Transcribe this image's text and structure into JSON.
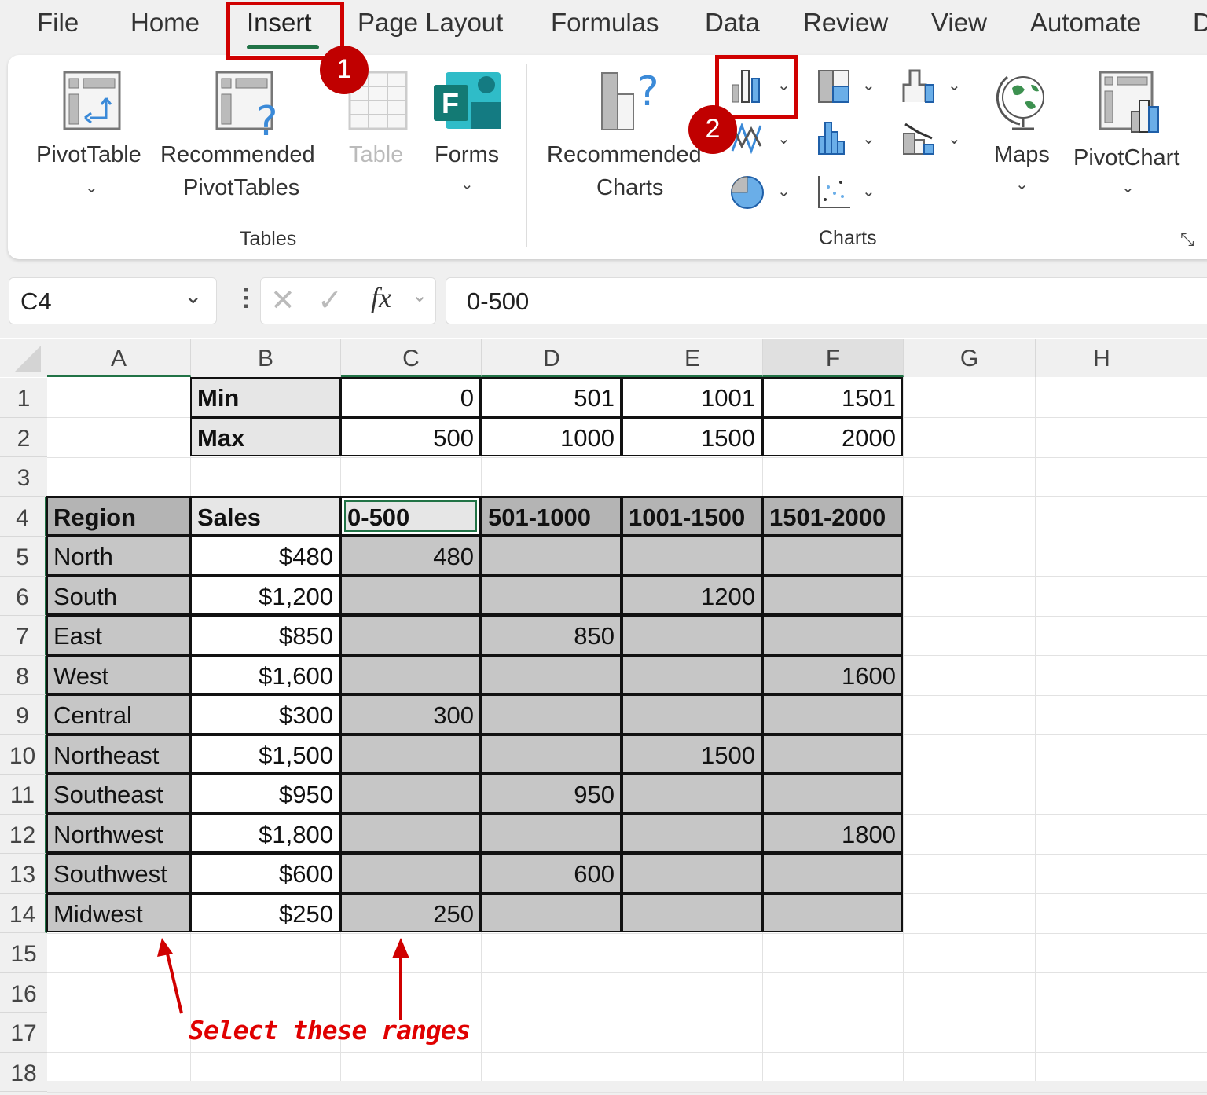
{
  "menu": {
    "tabs": [
      "File",
      "Home",
      "Insert",
      "Page Layout",
      "Formulas",
      "Data",
      "Review",
      "View",
      "Automate",
      "D"
    ],
    "active": "Insert"
  },
  "ribbon": {
    "tables_group": "Tables",
    "charts_group": "Charts",
    "pivottable": "PivotTable",
    "recommended_pivot_1": "Recommended",
    "recommended_pivot_2": "PivotTables",
    "table": "Table",
    "forms": "Forms",
    "recommended_charts_1": "Recommended",
    "recommended_charts_2": "Charts",
    "maps": "Maps",
    "pivotchart": "PivotChart"
  },
  "badges": {
    "step1": "1",
    "step2": "2"
  },
  "formula_bar": {
    "name_box": "C4",
    "fx": "fx",
    "value": "0-500"
  },
  "columns": [
    "A",
    "B",
    "C",
    "D",
    "E",
    "F",
    "G",
    "H"
  ],
  "rows": [
    "1",
    "2",
    "3",
    "4",
    "5",
    "6",
    "7",
    "8",
    "9",
    "10",
    "11",
    "12",
    "13",
    "14",
    "15",
    "16",
    "17",
    "18"
  ],
  "bins": {
    "min_label": "Min",
    "max_label": "Max",
    "min": [
      "0",
      "501",
      "1001",
      "1501"
    ],
    "max": [
      "500",
      "1000",
      "1500",
      "2000"
    ]
  },
  "table": {
    "headers": [
      "Region",
      "Sales",
      "0-500",
      "501-1000",
      "1001-1500",
      "1501-2000"
    ],
    "rows": [
      [
        "North",
        "$480",
        "480",
        "",
        "",
        ""
      ],
      [
        "South",
        "$1,200",
        "",
        "",
        "1200",
        ""
      ],
      [
        "East",
        "$850",
        "",
        "850",
        "",
        ""
      ],
      [
        "West",
        "$1,600",
        "",
        "",
        "",
        "1600"
      ],
      [
        "Central",
        "$300",
        "300",
        "",
        "",
        ""
      ],
      [
        "Northeast",
        "$1,500",
        "",
        "",
        "1500",
        ""
      ],
      [
        "Southeast",
        "$950",
        "",
        "950",
        "",
        ""
      ],
      [
        "Northwest",
        "$1,800",
        "",
        "",
        "",
        "1800"
      ],
      [
        "Southwest",
        "$600",
        "",
        "600",
        "",
        ""
      ],
      [
        "Midwest",
        "$250",
        "250",
        "",
        "",
        ""
      ]
    ]
  },
  "annotation": "Select these ranges",
  "colors": {
    "accent": "#217346",
    "highlight": "#d00000",
    "selected_fill": "#c6c6c6"
  }
}
